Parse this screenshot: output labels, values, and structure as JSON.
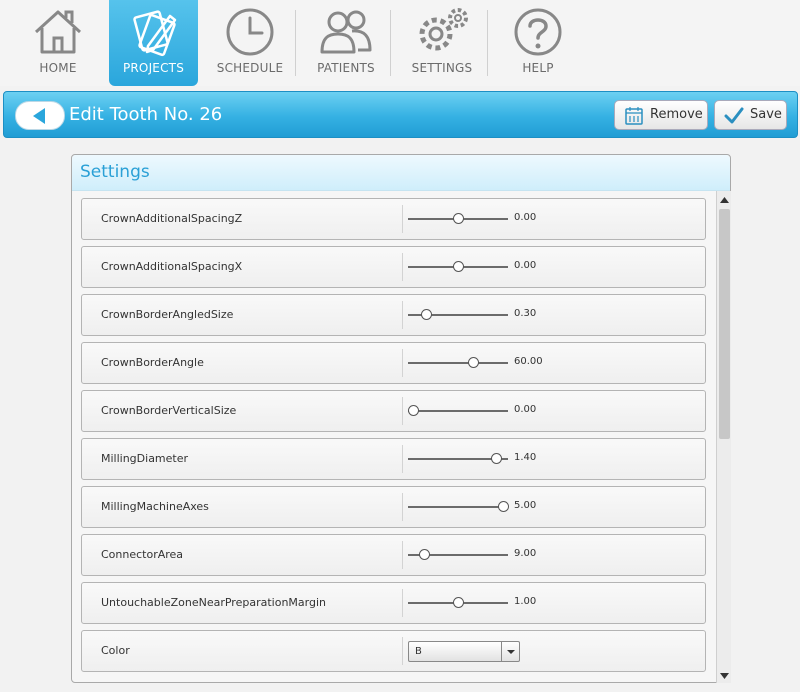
{
  "nav": {
    "items": [
      {
        "label": "HOME",
        "icon": "house-icon"
      },
      {
        "label": "PROJECTS",
        "icon": "projects-icon",
        "active": true
      },
      {
        "label": "SCHEDULE",
        "icon": "clock-icon"
      },
      {
        "label": "PATIENTS",
        "icon": "people-icon"
      },
      {
        "label": "SETTINGS",
        "icon": "gears-icon"
      },
      {
        "label": "HELP",
        "icon": "question-icon"
      }
    ]
  },
  "titlebar": {
    "title": "Edit Tooth No. 26",
    "remove_label": "Remove",
    "save_label": "Save"
  },
  "panel": {
    "title": "Settings",
    "rows": [
      {
        "label": "CrownAdditionalSpacingZ",
        "value": "0.00",
        "position": 0.5
      },
      {
        "label": "CrownAdditionalSpacingX",
        "value": "0.00",
        "position": 0.5
      },
      {
        "label": "CrownBorderAngledSize",
        "value": "0.30",
        "position": 0.18
      },
      {
        "label": "CrownBorderAngle",
        "value": "60.00",
        "position": 0.65
      },
      {
        "label": "CrownBorderVerticalSize",
        "value": "0.00",
        "position": 0.05
      },
      {
        "label": "MillingDiameter",
        "value": "1.40",
        "position": 0.88
      },
      {
        "label": "MillingMachineAxes",
        "value": "5.00",
        "position": 0.95
      },
      {
        "label": "ConnectorArea",
        "value": "9.00",
        "position": 0.16
      },
      {
        "label": "UntouchableZoneNearPreparationMargin",
        "value": "1.00",
        "position": 0.5
      }
    ],
    "color_row": {
      "label": "Color",
      "value": "B"
    }
  },
  "colors": {
    "accent": "#2aa6dc",
    "title_bar": "#35b1e3",
    "panel_title": "#2aa0d6"
  }
}
